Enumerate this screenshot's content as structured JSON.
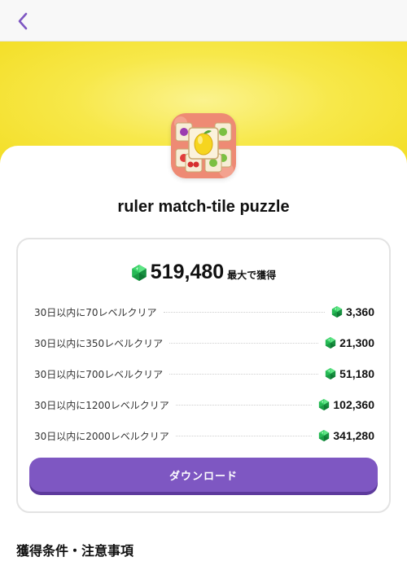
{
  "header": {
    "back_icon": "chevron-left-icon"
  },
  "app": {
    "title": "ruler match-tile puzzle",
    "icon": "fruit-tile-app-icon"
  },
  "reward": {
    "total": "519,480",
    "total_suffix": "最大で獲得",
    "currency_icon": "green-gem-icon",
    "items": [
      {
        "label": "30日以内に70レベルクリア",
        "value": "3,360"
      },
      {
        "label": "30日以内に350レベルクリア",
        "value": "21,300"
      },
      {
        "label": "30日以内に700レベルクリア",
        "value": "51,180"
      },
      {
        "label": "30日以内に1200レベルクリア",
        "value": "102,360"
      },
      {
        "label": "30日以内に2000レベルクリア",
        "value": "341,280"
      }
    ]
  },
  "actions": {
    "download_label": "ダウンロード"
  },
  "conditions": {
    "heading": "獲得条件・注意事項"
  },
  "colors": {
    "accent": "#7e57c2",
    "hero": "#f7e84a",
    "gem": "#2ecc71"
  }
}
